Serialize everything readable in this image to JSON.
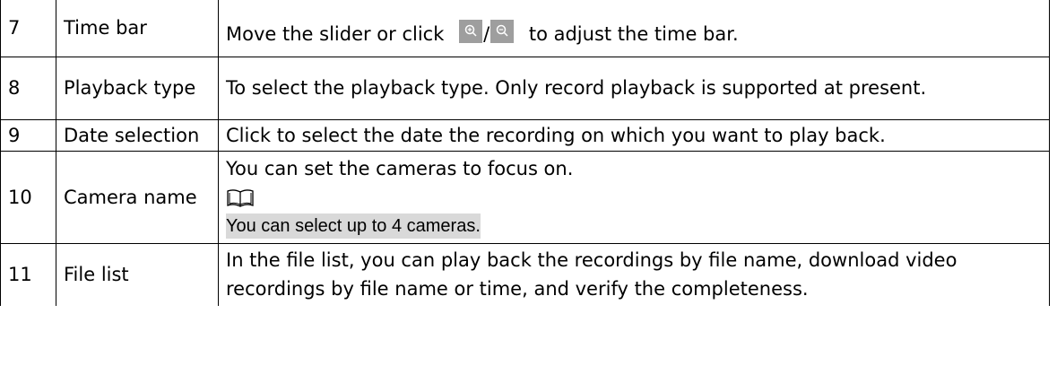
{
  "rows": [
    {
      "num": "7",
      "name": "Time bar",
      "desc_before": "Move the slider or click",
      "desc_after": "to adjust the time bar.",
      "icons": [
        "zoom-in-icon",
        "zoom-out-icon"
      ],
      "separator": "/"
    },
    {
      "num": "8",
      "name": "Playback type",
      "desc": "To select the playback type. Only record playback is supported at present."
    },
    {
      "num": "9",
      "name": "Date selection",
      "desc": "Click to select the date the recording on which you want to play back."
    },
    {
      "num": "10",
      "name": "Camera name",
      "desc": "You can set the cameras to focus on.",
      "note_icon": "book-note-icon",
      "note": "You can select up to 4 cameras."
    },
    {
      "num": "11",
      "name": "File list",
      "desc": "In the file list, you can play back the recordings by file name, download video recordings by file name or time, and verify the completeness."
    }
  ],
  "colors": {
    "border": "#000000",
    "icon_bg": "#9e9e9e",
    "note_highlight": "#d9d9d9"
  }
}
